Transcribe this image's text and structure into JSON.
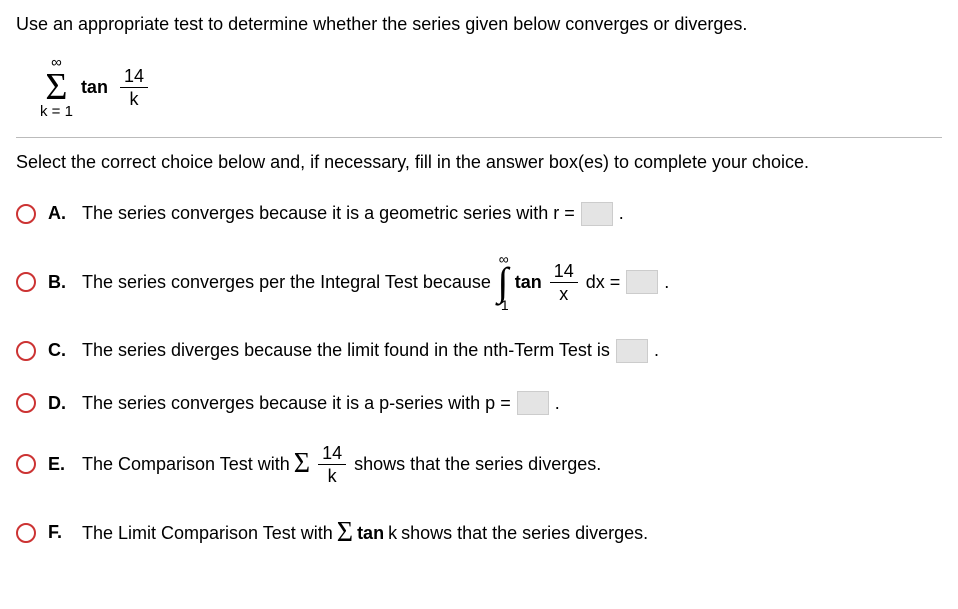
{
  "question": "Use an appropriate test to determine whether the series given below converges or diverges.",
  "series": {
    "upper": "∞",
    "lower": "k = 1",
    "func": "tan",
    "frac_num": "14",
    "frac_den": "k"
  },
  "instruction": "Select the correct choice below and, if necessary, fill in the answer box(es) to complete your choice.",
  "options": {
    "A": {
      "label": "A.",
      "text1": "The series converges because it is a geometric series with r =",
      "period": "."
    },
    "B": {
      "label": "B.",
      "text1": "The series converges per the Integral Test because",
      "int_upper": "∞",
      "int_lower": "1",
      "func": "tan",
      "frac_num": "14",
      "frac_den": "x",
      "text2": "dx =",
      "period": "."
    },
    "C": {
      "label": "C.",
      "text1": "The series diverges because the limit found in the nth-Term Test is",
      "period": "."
    },
    "D": {
      "label": "D.",
      "text1": "The series converges because it is a p-series with p =",
      "period": "."
    },
    "E": {
      "label": "E.",
      "text1": "The Comparison Test with",
      "frac_num": "14",
      "frac_den": "k",
      "text2": "shows that the series diverges."
    },
    "F": {
      "label": "F.",
      "text1": "The Limit Comparison Test with",
      "func": "tan",
      "var": "k",
      "text2": "shows that the series diverges."
    }
  }
}
